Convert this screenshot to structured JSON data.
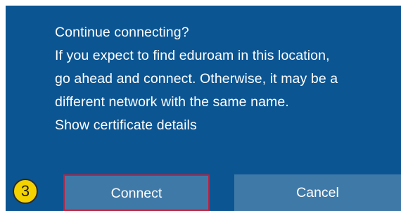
{
  "dialog": {
    "lines": [
      "Continue connecting?",
      "If you expect to find eduroam in this location,",
      "go ahead and connect. Otherwise, it may be a",
      "different network with the same name.",
      "Show certificate details"
    ],
    "connect_label": "Connect",
    "cancel_label": "Cancel"
  },
  "annotation": {
    "step_number": "3"
  },
  "colors": {
    "panel_background": "#0b5593",
    "button_background": "#3f79a8",
    "highlight_border": "#c2203d",
    "badge_fill": "#f4d200"
  }
}
